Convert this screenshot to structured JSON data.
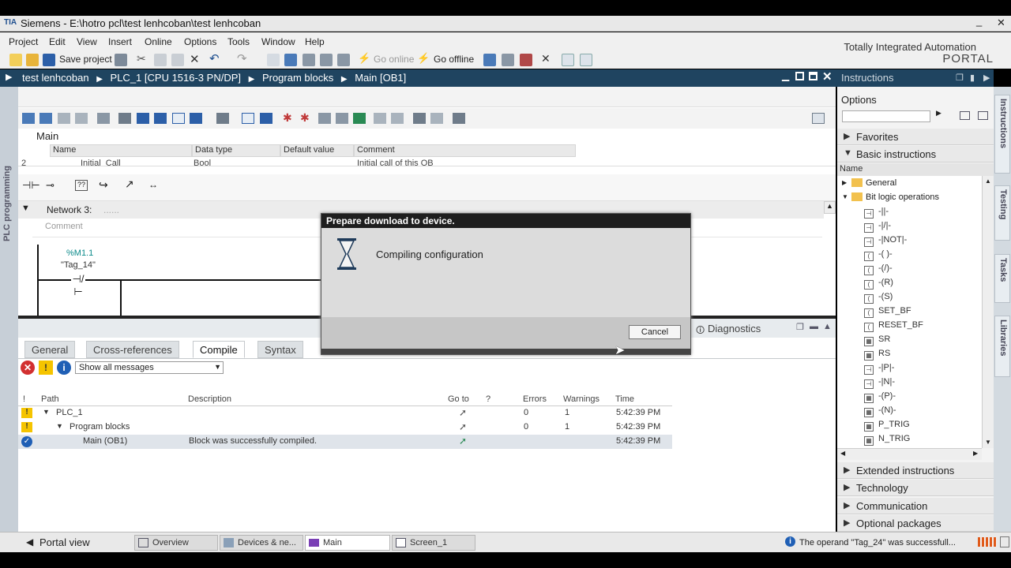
{
  "window": {
    "title": "Siemens - E:\\hotro pcl\\test lenhcoban\\test lenhcoban",
    "min_label": "_",
    "close_label": "✕"
  },
  "menu": [
    "Project",
    "Edit",
    "View",
    "Insert",
    "Online",
    "Options",
    "Tools",
    "Window",
    "Help"
  ],
  "brand": {
    "line1": "Totally Integrated Automation",
    "line2": "PORTAL"
  },
  "toolbar": {
    "save_label": "Save project",
    "go_online_label": "Go online",
    "go_offline_label": "Go offline"
  },
  "breadcrumb": [
    "test lenhcoban",
    "PLC_1 [CPU 1516-3 PN/DP]",
    "Program blocks",
    "Main [OB1]"
  ],
  "side_label": "PLC programming",
  "editor": {
    "block_name": "Main",
    "columns": [
      "Name",
      "Data type",
      "Default value",
      "Comment"
    ],
    "row": {
      "index": "2",
      "name": "Initial_Call",
      "type": "Bool",
      "comment": "Initial call of this OB"
    },
    "network_label": "Network 3:",
    "network_title": "......",
    "comment_placeholder": "Comment",
    "contact_address": "%M1.1",
    "contact_tag": "\"Tag_14\""
  },
  "dialog": {
    "title": "Prepare download to device.",
    "message": "Compiling configuration",
    "cancel_label": "Cancel"
  },
  "inspector": {
    "tabs": [
      "General",
      "Cross-references",
      "Compile",
      "Syntax"
    ],
    "active_tab": "Compile",
    "diagnostics_label": "Diagnostics",
    "filter_value": "Show all messages",
    "columns": [
      "!",
      "Path",
      "Description",
      "Go to",
      "?",
      "Errors",
      "Warnings",
      "Time"
    ],
    "rows": [
      {
        "path": "PLC_1",
        "description": "",
        "errors": "0",
        "warnings": "1",
        "time": "5:42:39 PM",
        "status": "warning"
      },
      {
        "path": "Program blocks",
        "description": "",
        "errors": "0",
        "warnings": "1",
        "time": "5:42:39 PM",
        "status": "warning"
      },
      {
        "path": "Main (OB1)",
        "description": "Block was successfully compiled.",
        "errors": "",
        "warnings": "",
        "time": "5:42:39 PM",
        "status": "ok"
      }
    ]
  },
  "instructions": {
    "header": "Instructions",
    "options_label": "Options",
    "favorites": "Favorites",
    "basic": "Basic instructions",
    "name_col": "Name",
    "folders": [
      "General",
      "Bit logic operations"
    ],
    "items": [
      "-||-",
      "-|/|-",
      "-|NOT|-",
      "-( )-",
      "-(/)-",
      "-(R)",
      "-(S)",
      "SET_BF",
      "RESET_BF",
      "SR",
      "RS",
      "-|P|-",
      "-|N|-",
      "-(P)-",
      "-(N)-",
      "P_TRIG",
      "N_TRIG"
    ],
    "sections": [
      "Extended instructions",
      "Technology",
      "Communication",
      "Optional packages"
    ]
  },
  "right_tabs": [
    "Instructions",
    "Testing",
    "Tasks",
    "Libraries"
  ],
  "taskbar": {
    "portal_view": "Portal view",
    "tasks": [
      "Overview",
      "Devices & ne...",
      "Main",
      "Screen_1"
    ],
    "active_task": "Main",
    "status": "The operand \"Tag_24\" was successfull..."
  },
  "colors": {
    "header_blue": "#1f4460",
    "accent_teal": "#0b8a8a",
    "warning_yellow": "#f5c400",
    "ok_blue": "#1f5fb5"
  }
}
